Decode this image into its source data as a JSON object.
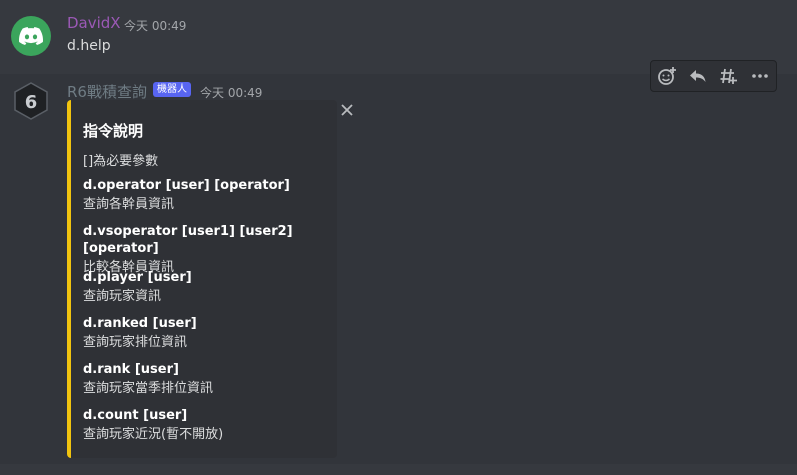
{
  "message1": {
    "author": "DavidX",
    "timestamp": "今天 00:49",
    "content": "d.help"
  },
  "message2": {
    "author": "R6戰積查詢",
    "badge": "機器人",
    "timestamp": "今天 00:49",
    "embed": {
      "accent_color": "#f1c40f",
      "title": "指令說明",
      "description": "[]為必要參數",
      "fields": [
        {
          "name": "d.operator [user] [operator]",
          "value": "查詢各幹員資訊"
        },
        {
          "name": "d.vsoperator [user1] [user2] [operator]",
          "value": "比較各幹員資訊"
        },
        {
          "name": "d.player [user]",
          "value": "查詢玩家資訊"
        },
        {
          "name": "d.ranked [user]",
          "value": "查詢玩家排位資訊"
        },
        {
          "name": "d.rank [user]",
          "value": "查詢玩家當季排位資訊"
        },
        {
          "name": "d.count [user]",
          "value": "查詢玩家近況(暫不開放)"
        }
      ]
    }
  },
  "toolbar": {
    "icons": [
      "add-reaction-icon",
      "reply-icon",
      "create-thread-icon",
      "more-icon"
    ]
  },
  "colors": {
    "background": "#36393f",
    "discord_green": "#3ba55c",
    "blurple": "#5865f2",
    "username_purple": "#9b59b6"
  }
}
